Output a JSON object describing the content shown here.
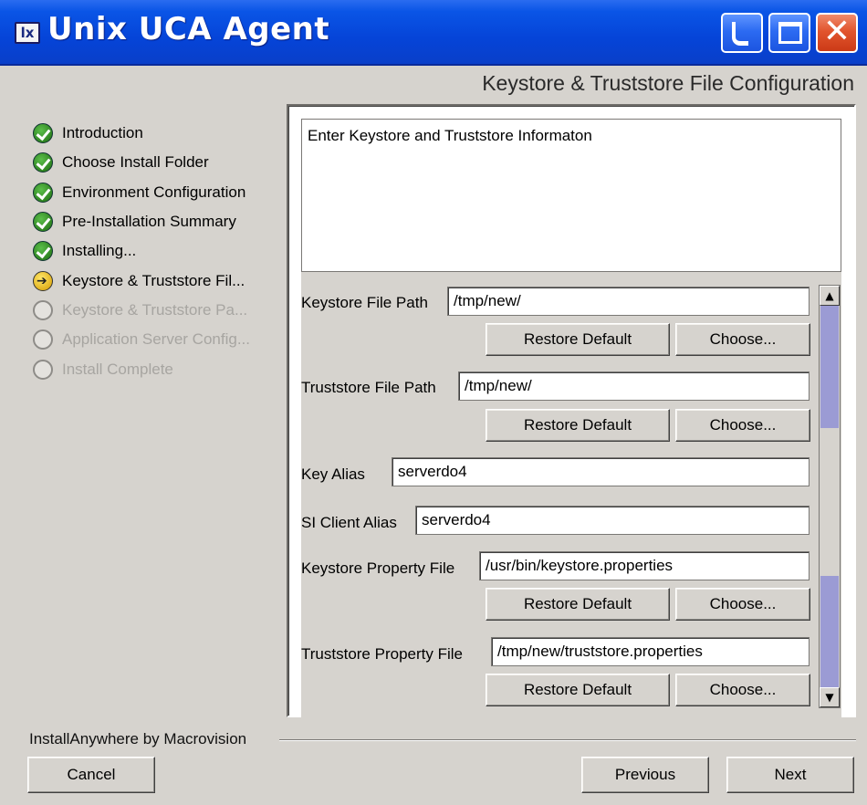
{
  "window": {
    "title": "Unix UCA  Agent",
    "icon_text": "lx",
    "controls": {
      "minimize_icon": "minimize-icon",
      "maximize_icon": "maximize-icon",
      "close_icon": "close-icon"
    }
  },
  "step_header": "Keystore & Truststore File Configuration",
  "steps": [
    {
      "label": "Introduction",
      "state": "done"
    },
    {
      "label": "Choose Install Folder",
      "state": "done"
    },
    {
      "label": "Environment Configuration",
      "state": "done"
    },
    {
      "label": "Pre-Installation Summary",
      "state": "done"
    },
    {
      "label": "Installing...",
      "state": "done"
    },
    {
      "label": "Keystore & Truststore Fil...",
      "state": "current"
    },
    {
      "label": "Keystore & Truststore Pa...",
      "state": "pending"
    },
    {
      "label": "Application Server  Config...",
      "state": "pending"
    },
    {
      "label": "Install Complete",
      "state": "pending"
    }
  ],
  "description": "Enter Keystore and Truststore Informaton",
  "form": {
    "keystore_file_path": {
      "label": "Keystore File Path",
      "value": "/tmp/new/"
    },
    "truststore_file_path": {
      "label": "Truststore File Path",
      "value": "/tmp/new/"
    },
    "key_alias": {
      "label": "Key Alias",
      "value": "serverdo4"
    },
    "si_client_alias": {
      "label": "SI Client Alias",
      "value": "serverdo4"
    },
    "keystore_property_file": {
      "label": "Keystore Property File",
      "value": "/usr/bin/keystore.properties"
    },
    "truststore_property_file": {
      "label": "Truststore Property File",
      "value": "/tmp/new/truststore.properties"
    },
    "restore_default_label": "Restore Default",
    "choose_label": "Choose..."
  },
  "footer": {
    "brand": "InstallAnywhere by Macrovision",
    "cancel": "Cancel",
    "previous": "Previous",
    "next": "Next"
  }
}
